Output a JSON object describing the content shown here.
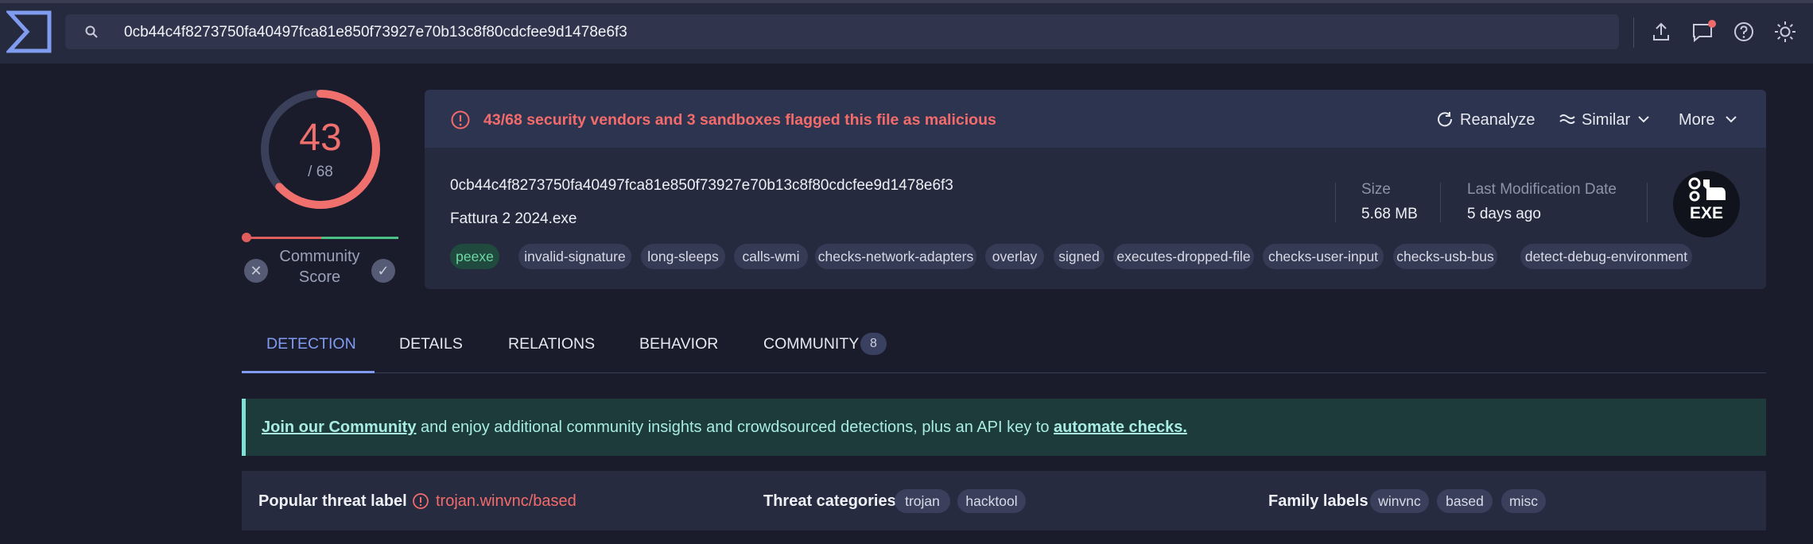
{
  "search": {
    "value": "0cb44c4f8273750fa40497fca81e850f73927e70b13c8f80cdcfee9d1478e6f3"
  },
  "header_icons": [
    "upload-icon",
    "chat-icon",
    "help-icon",
    "theme-icon"
  ],
  "score": {
    "detected": "43",
    "total": "/ 68",
    "ratio": 0.632,
    "community_label_1": "Community",
    "community_label_2": "Score",
    "community_value": -0.5
  },
  "alert": {
    "text": "43/68 security vendors and 3 sandboxes flagged this file as malicious",
    "actions": {
      "reanalyze": "Reanalyze",
      "similar": "Similar",
      "more": "More"
    }
  },
  "file": {
    "hash": "0cb44c4f8273750fa40497fca81e850f73927e70b13c8f80cdcfee9d1478e6f3",
    "name": "Fattura 2 2024.exe",
    "size_label": "Size",
    "size_value": "5.68 MB",
    "date_label": "Last Modification Date",
    "date_value": "5 days ago",
    "type": "EXE"
  },
  "tags": [
    "peexe",
    "invalid-signature",
    "long-sleeps",
    "calls-wmi",
    "checks-network-adapters",
    "overlay",
    "signed",
    "executes-dropped-file",
    "checks-user-input",
    "checks-usb-bus",
    "detect-debug-environment"
  ],
  "tabs": {
    "detection": "DETECTION",
    "details": "DETAILS",
    "relations": "RELATIONS",
    "behavior": "BEHAVIOR",
    "community": "COMMUNITY",
    "community_count": "8"
  },
  "banner": {
    "link1": "Join our Community",
    "middle": " and enjoy additional community insights and crowdsourced detections, plus an API key to ",
    "link2": "automate checks."
  },
  "threat": {
    "popular_label": "Popular threat label",
    "popular_value": "trojan.winvnc/based",
    "categories_label": "Threat categories",
    "categories": [
      "trojan",
      "hacktool"
    ],
    "family_label": "Family labels",
    "families": [
      "winvnc",
      "based",
      "misc"
    ]
  },
  "colors": {
    "malicious": "#f36b6b",
    "accent": "#7f9cf0",
    "banner": "#a8ece3"
  }
}
